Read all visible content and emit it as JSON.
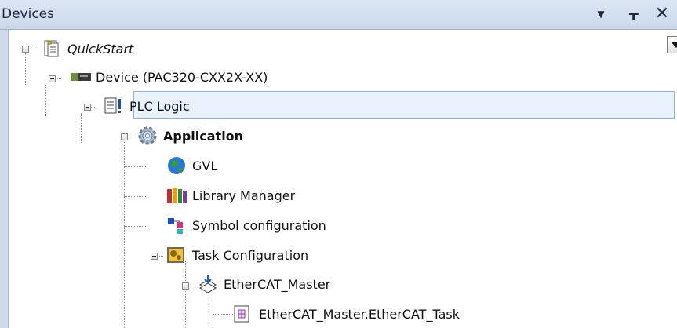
{
  "panel": {
    "title": "Devices"
  },
  "titlebar_buttons": {
    "menu": "▾",
    "pin": "ꟷ",
    "close": "✕"
  },
  "tree": {
    "project": "QuickStart",
    "device": "Device (PAC320-CXX2X-XX)",
    "plc_logic": "PLC Logic",
    "application": "Application",
    "gvl": "GVL",
    "library_manager": "Library Manager",
    "symbol_configuration": "Symbol configuration",
    "task_configuration": "Task Configuration",
    "ethercat_master": "EtherCAT_Master",
    "ethercat_task": "EtherCAT_Master.EtherCAT_Task"
  },
  "icons": {
    "project": "project-file-icon",
    "device": "device-icon",
    "plc_logic": "plc-logic-icon",
    "application": "gear-icon",
    "gvl": "globe-icon",
    "library_manager": "library-icon",
    "symbol_configuration": "symbol-config-icon",
    "task_configuration": "task-config-icon",
    "ethercat_master": "ethercat-master-icon",
    "ethercat_task": "task-icon"
  },
  "colors": {
    "selection": "#e9f2fc",
    "selection_border": "#8bb4e6",
    "titlebar": "#d4dfee"
  }
}
